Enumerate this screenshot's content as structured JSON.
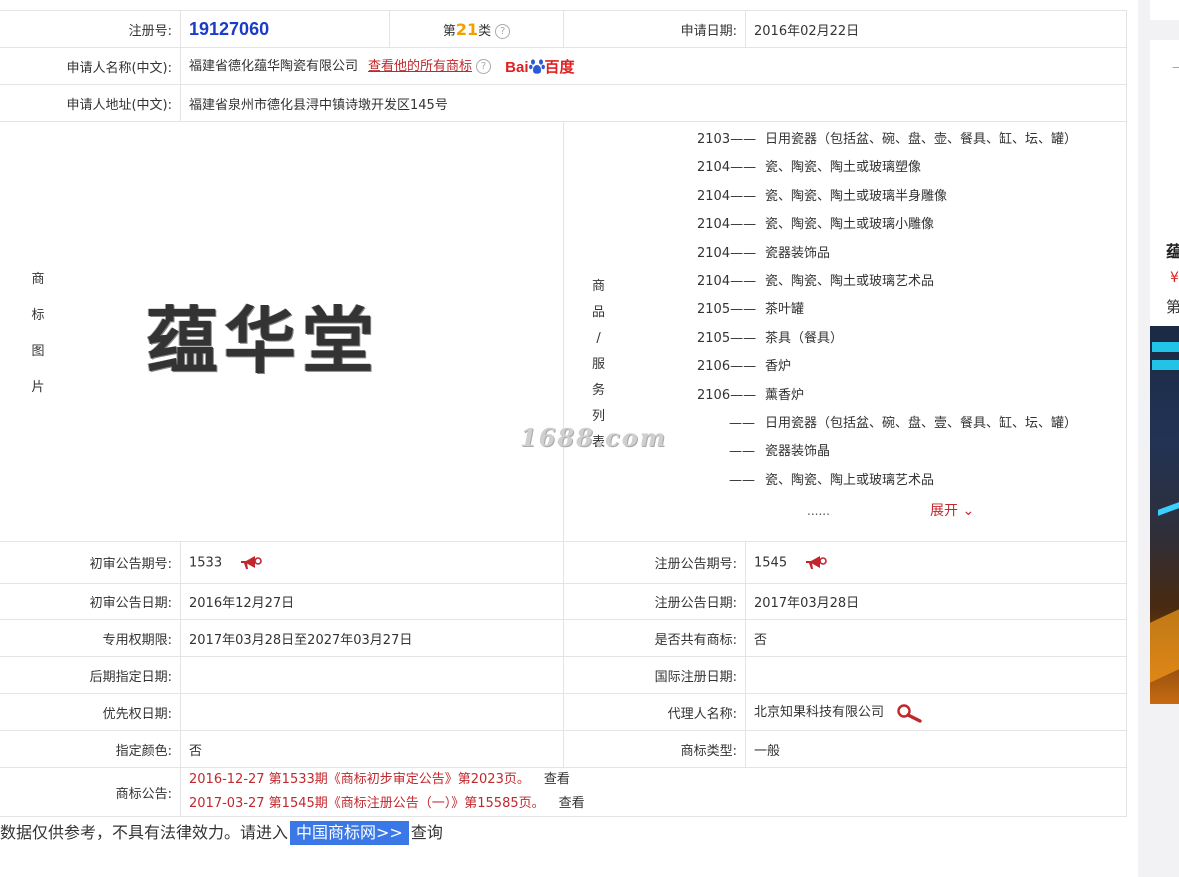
{
  "registration": {
    "label": "注册号:",
    "number": "19127060",
    "class_prefix": "第",
    "class_number": "21",
    "class_suffix": "类",
    "apply_date_label": "申请日期:",
    "apply_date": "2016年02月22日"
  },
  "applicant": {
    "name_label": "申请人名称(中文):",
    "name": "福建省德化蕴华陶瓷有限公司",
    "all_marks_link": "查看他的所有商标",
    "baidu_logo": "Bai百度",
    "address_label": "申请人地址(中文):",
    "address": "福建省泉州市德化县浔中镇诗墩开发区145号"
  },
  "mark": {
    "image_label": [
      "商",
      "标",
      "图",
      "片"
    ],
    "image_text": "蕴华堂",
    "goods_label": [
      "商",
      "品",
      "/",
      "服",
      "务",
      "列",
      "表"
    ],
    "watermark": "1688.com"
  },
  "goods": [
    {
      "code": "2103——",
      "text": "日用瓷器（包括盆、碗、盘、壶、餐具、缸、坛、罐）"
    },
    {
      "code": "2104——",
      "text": "瓷、陶瓷、陶土或玻璃塑像"
    },
    {
      "code": "2104——",
      "text": "瓷、陶瓷、陶土或玻璃半身雕像"
    },
    {
      "code": "2104——",
      "text": "瓷、陶瓷、陶土或玻璃小雕像"
    },
    {
      "code": "2104——",
      "text": "瓷器装饰品"
    },
    {
      "code": "2104——",
      "text": "瓷、陶瓷、陶土或玻璃艺术品"
    },
    {
      "code": "2105——",
      "text": "茶叶罐"
    },
    {
      "code": "2105——",
      "text": "茶具（餐具）"
    },
    {
      "code": "2106——",
      "text": "香炉"
    },
    {
      "code": "2106——",
      "text": "薰香炉"
    }
  ],
  "goods_sub": [
    {
      "code": "——",
      "text": "日用瓷器（包括盆、碗、盘、壹、餐具、缸、坛、罐）"
    },
    {
      "code": "——",
      "text": "瓷器装饰晶"
    },
    {
      "code": "——",
      "text": "瓷、陶瓷、陶上或玻璃艺术品"
    },
    {
      "code": "",
      "text": "日用瓷器（包括盆、碗、盘、壹、餐具、缸、坛、罐）"
    }
  ],
  "goods_more": "......",
  "goods_expand": "展开",
  "details": {
    "prelim_no_label": "初审公告期号:",
    "prelim_no": "1533",
    "reg_notice_no_label": "注册公告期号:",
    "reg_notice_no": "1545",
    "prelim_date_label": "初审公告日期:",
    "prelim_date": "2016年12月27日",
    "reg_notice_date_label": "注册公告日期:",
    "reg_notice_date": "2017年03月28日",
    "validity_label": "专用权期限:",
    "validity": "2017年03月28日至2027年03月27日",
    "shared_label": "是否共有商标:",
    "shared": "否",
    "later_date_label": "后期指定日期:",
    "later_date": "",
    "intl_date_label": "国际注册日期:",
    "intl_date": "",
    "priority_label": "优先权日期:",
    "priority": "",
    "agent_label": "代理人名称:",
    "agent": "北京知果科技有限公司",
    "color_label": "指定颜色:",
    "color": "否",
    "type_label": "商标类型:",
    "type": "一般",
    "notices_label": "商标公告:"
  },
  "notices": [
    {
      "text": "2016-12-27 第1533期《商标初步审定公告》第2023页。",
      "view": "查看"
    },
    {
      "text": "2017-03-27 第1545期《商标注册公告（一）》第15585页。",
      "view": "查看"
    }
  ],
  "footer": {
    "text": "数据仅供参考，不具有法律效力。请进入",
    "link": "中国商标网>>",
    "suffix": "查询"
  },
  "sidebar": {
    "dash": "—",
    "title": "蕴",
    "price": "¥",
    "sub": "第"
  },
  "colors": {
    "accent_red": "#c0282d",
    "reg_blue": "#1a3cc8",
    "class_orange": "#f0a000",
    "link_blue": "#3b78e7"
  }
}
